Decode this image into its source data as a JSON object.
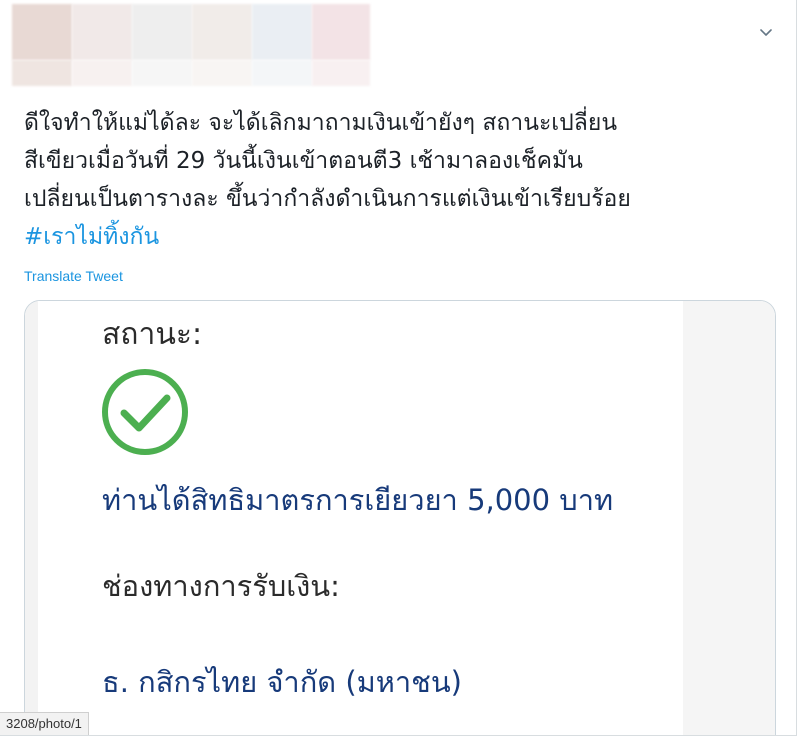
{
  "tweet": {
    "text_lines": [
      "ดีใจทำให้แม่ได้ละ จะได้เลิกมาถามเงินเข้ายังๆ สถานะเปลี่ยน",
      "สีเขียวเมื่อวันที่ 29 วันนี้เงินเข้าตอนตี3 เช้ามาลองเช็คมัน",
      "เปลี่ยนเป็นตารางละ ขึ้นว่ากำลังดำเนินการแต่เงินเข้าเรียบร้อย"
    ],
    "hashtag": "#เราไม่ทิ้งกัน",
    "translate_label": "Translate Tweet",
    "menu_icon": "chevron-down-icon"
  },
  "media": {
    "status_label": "สถานะ:",
    "status_icon": "check-circle-icon",
    "status_color": "#4caf50",
    "entitlement_text": "ท่านได้สิทธิมาตรการเยียวยา 5,000 บาท",
    "channel_label": "ช่องทางการรับเงิน:",
    "bank_name": "ธ. กสิกรไทย จำกัด (มหาชน)"
  },
  "status_bar": {
    "url": "3208/photo/1"
  },
  "colors": {
    "link": "#1b95e0",
    "text": "#1c2127",
    "navy": "#173a7a"
  }
}
